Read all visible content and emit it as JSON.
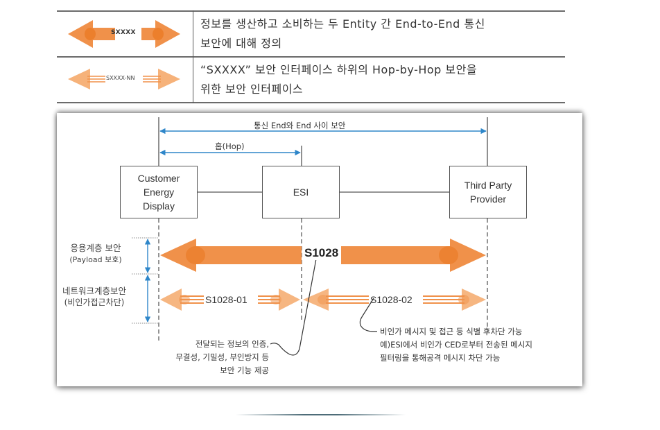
{
  "legend": {
    "rows": [
      {
        "arrow_label": "SXXXX",
        "arrow_style": "thick-bidirectional",
        "description_lines": [
          "정보를 생산하고 소비하는 두 Entity 간 End-to-End 통신",
          "보안에 대해 정의"
        ]
      },
      {
        "arrow_label": "SXXXX-NN",
        "arrow_style": "triple-line-bidirectional",
        "description_lines": [
          "“SXXXX” 보안 인터페이스 하위의 Hop-by-Hop 보안을",
          "위한 보안 인터페이스"
        ]
      }
    ]
  },
  "diagram": {
    "end_to_end_label": "통신 End와 End 사이 보안",
    "hop_label": "홉(Hop)",
    "nodes": {
      "ced": "Customer\nEnergy\nDisplay",
      "esi": "ESI",
      "tpp": "Third Party\nProvider"
    },
    "layers": {
      "application": {
        "line1": "응용계층 보안",
        "line2": "(Payload 보호)"
      },
      "network": {
        "line1": "네트워크계층보안",
        "line2": "(비인가접근차단)"
      }
    },
    "arrows": {
      "main": "S1028",
      "hop1": "S1028-01",
      "hop2": "S1028-02"
    },
    "notes": {
      "main_note": [
        "전달되는 정보의 인증,",
        "무결성, 기밀성, 부인방지 등",
        "보안 기능 제공"
      ],
      "hop_note": [
        "비인가 메시지 및 접근 등 식별 후차단 가능",
        "예)ESI에서 비인가 CED로부터 전송된 메시지",
        "필터링을 통해공격 메시지 차단 가능"
      ]
    }
  },
  "colors": {
    "orange": "#f0914a",
    "orange_dark": "#e9771f",
    "orange_light": "#f6b27a",
    "blue": "#2e86c9",
    "line": "#555555"
  }
}
